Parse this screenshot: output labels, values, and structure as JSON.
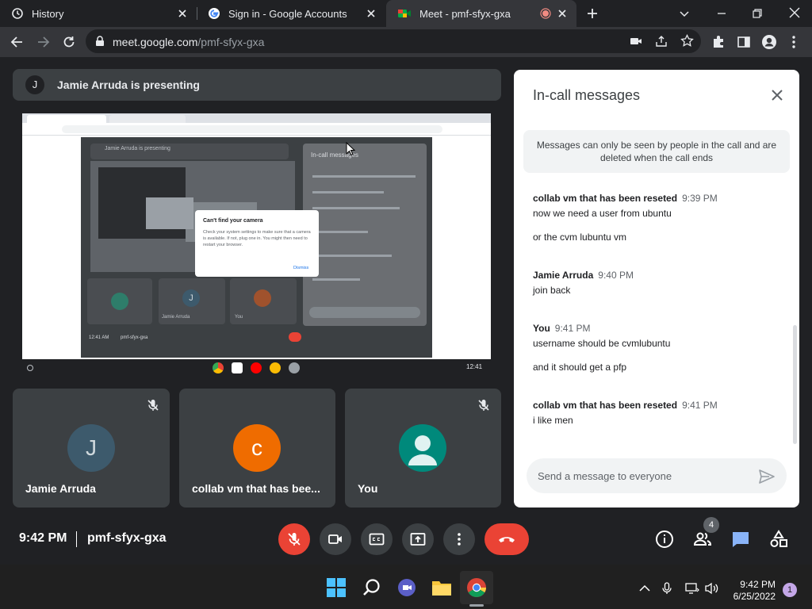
{
  "browser": {
    "tabs": [
      {
        "title": "History"
      },
      {
        "title": "Sign in - Google Accounts"
      },
      {
        "title": "Meet - pmf-sfyx-gxa"
      }
    ],
    "url_host": "meet.google.com",
    "url_path": "/pmf-sfyx-gxa"
  },
  "meet": {
    "presenter_initial": "J",
    "presenting_text": "Jamie Arruda is presenting",
    "participants": [
      {
        "initial": "J",
        "name": "Jamie Arruda",
        "color": "#3d5a6c",
        "muted": true
      },
      {
        "initial": "c",
        "name": "collab vm that has bee...",
        "color": "#ef6c00",
        "muted": false
      },
      {
        "initial": "",
        "name": "You",
        "color": "#00897b",
        "muted": true
      }
    ],
    "clock": "9:42 PM",
    "meeting_code": "pmf-sfyx-gxa",
    "people_count": "4"
  },
  "shared_screen": {
    "inner_dialog_title": "Can't find your camera",
    "inner_dialog_body": "Check your system settings to make sure that a camera is available. If not, plug one in. You might then need to restart your browser.",
    "inner_dialog_button": "Dismiss",
    "inner_presenting": "Jamie Arruda is presenting",
    "inner_chat_title": "In-call messages",
    "inner_clock": "12:41 AM",
    "inner_code": "pmf-sfyx-gxa",
    "inner_tile_names": [
      "Jamie Arruda",
      "You"
    ],
    "taskbar_time": "12:41"
  },
  "chat": {
    "title": "In-call messages",
    "notice": "Messages can only be seen by people in the call and are deleted when the call ends",
    "groups": [
      {
        "sender": "collab vm that has been reseted",
        "time": "9:39 PM",
        "lines": [
          "now we need a user from ubuntu",
          "or the cvm lubuntu vm"
        ]
      },
      {
        "sender": "Jamie Arruda",
        "time": "9:40 PM",
        "lines": [
          "join back"
        ]
      },
      {
        "sender": "You",
        "time": "9:41 PM",
        "lines": [
          "username should be cvmlubuntu",
          "and it should get a pfp"
        ]
      },
      {
        "sender": "collab vm that has been reseted",
        "time": "9:41 PM",
        "lines": [
          "i like men"
        ]
      }
    ],
    "input_placeholder": "Send a message to everyone"
  },
  "taskbar": {
    "time": "9:42 PM",
    "date": "6/25/2022",
    "notification_count": "1"
  },
  "colors": {
    "meet_red": "#ea4335",
    "meet_blue": "#8ab4f8",
    "background": "#202124"
  }
}
